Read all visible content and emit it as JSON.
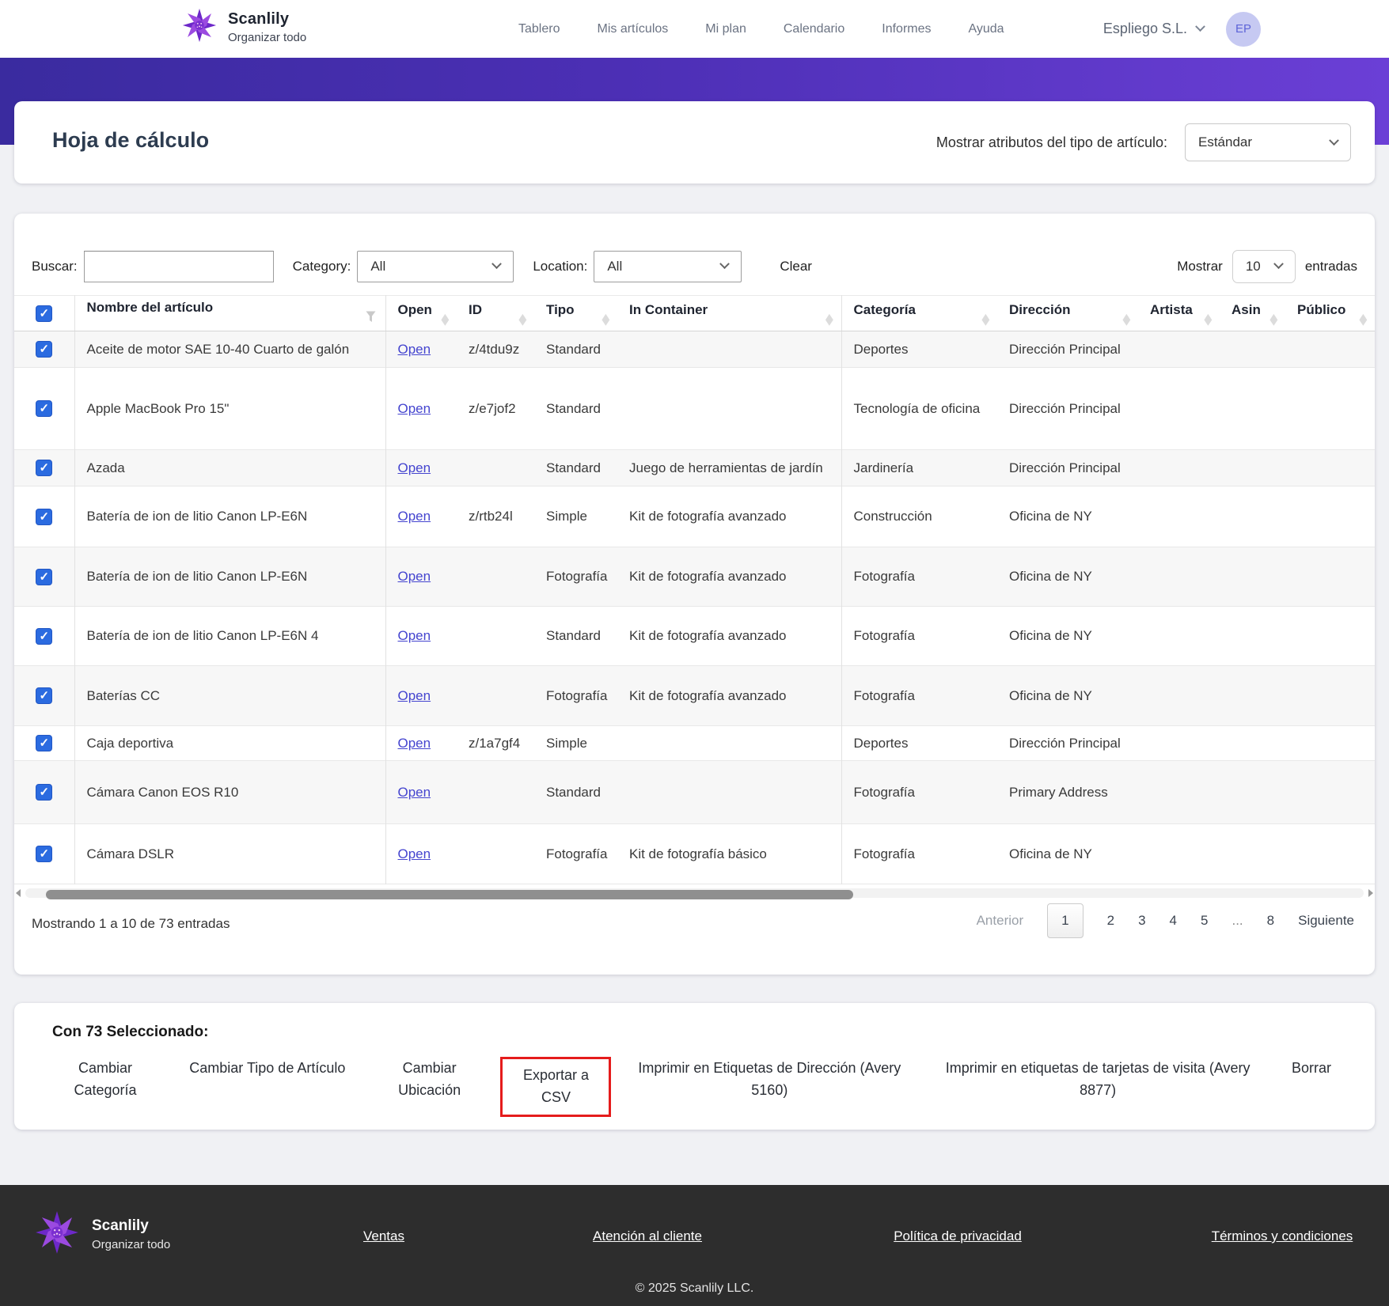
{
  "header": {
    "brand": {
      "name": "Scanlily",
      "tagline": "Organizar todo"
    },
    "nav": [
      {
        "key": "tablero",
        "label": "Tablero"
      },
      {
        "key": "mis-articulos",
        "label": "Mis artículos"
      },
      {
        "key": "mi-plan",
        "label": "Mi plan"
      },
      {
        "key": "calendario",
        "label": "Calendario"
      },
      {
        "key": "informes",
        "label": "Informes"
      },
      {
        "key": "ayuda",
        "label": "Ayuda"
      }
    ],
    "account": {
      "company": "Espliego S.L.",
      "avatar_initials": "EP"
    }
  },
  "page": {
    "title": "Hoja de cálculo",
    "attributes_label": "Mostrar atributos del tipo de artículo:",
    "attributes_value": "Estándar"
  },
  "filters": {
    "search_label": "Buscar:",
    "search_value": "",
    "category_label": "Category:",
    "category_value": "All",
    "location_label": "Location:",
    "location_value": "All",
    "clear_label": "Clear",
    "show_label": "Mostrar",
    "page_size": "10",
    "entries_label": "entradas"
  },
  "table": {
    "columns": [
      "Nombre del artículo",
      "Open",
      "ID",
      "Tipo",
      "In Container",
      "Categoría",
      "Dirección",
      "Artista",
      "Asin",
      "Público"
    ],
    "open_label": "Open",
    "rows": [
      {
        "name": "Aceite de motor SAE 10-40 Cuarto de galón",
        "id": "z/4tdu9z",
        "tipo": "Standard",
        "container": "",
        "categoria": "Deportes",
        "direccion": "Dirección Principal",
        "artista": "",
        "asin": "",
        "publico": ""
      },
      {
        "name": "Apple MacBook Pro 15\"",
        "id": "z/e7jof2",
        "tipo": "Standard",
        "container": "",
        "categoria": "Tecnología de oficina",
        "direccion": "Dirección Principal",
        "artista": "",
        "asin": "",
        "publico": ""
      },
      {
        "name": "Azada",
        "id": "",
        "tipo": "Standard",
        "container": "Juego de herramientas de jardín",
        "categoria": "Jardinería",
        "direccion": "Dirección Principal",
        "artista": "",
        "asin": "",
        "publico": ""
      },
      {
        "name": "Batería de ion de litio Canon LP-E6N",
        "id": "z/rtb24l",
        "tipo": "Simple",
        "container": "Kit de fotografía avanzado",
        "categoria": "Construcción",
        "direccion": "Oficina de NY",
        "artista": "",
        "asin": "",
        "publico": ""
      },
      {
        "name": "Batería de ion de litio Canon LP-E6N",
        "id": "",
        "tipo": "Fotografía",
        "container": "Kit de fotografía avanzado",
        "categoria": "Fotografía",
        "direccion": "Oficina de NY",
        "artista": "",
        "asin": "",
        "publico": ""
      },
      {
        "name": "Batería de ion de litio Canon LP-E6N 4",
        "id": "",
        "tipo": "Standard",
        "container": "Kit de fotografía avanzado",
        "categoria": "Fotografía",
        "direccion": "Oficina de NY",
        "artista": "",
        "asin": "",
        "publico": ""
      },
      {
        "name": "Baterías CC",
        "id": "",
        "tipo": "Fotografía",
        "container": "Kit de fotografía avanzado",
        "categoria": "Fotografía",
        "direccion": "Oficina de NY",
        "artista": "",
        "asin": "",
        "publico": ""
      },
      {
        "name": "Caja deportiva",
        "id": "z/1a7gf4",
        "tipo": "Simple",
        "container": "",
        "categoria": "Deportes",
        "direccion": "Dirección Principal",
        "artista": "",
        "asin": "",
        "publico": ""
      },
      {
        "name": "Cámara Canon EOS R10",
        "id": "",
        "tipo": "Standard",
        "container": "",
        "categoria": "Fotografía",
        "direccion": "Primary Address",
        "artista": "",
        "asin": "",
        "publico": ""
      },
      {
        "name": "Cámara DSLR",
        "id": "",
        "tipo": "Fotografía",
        "container": "Kit de fotografía básico",
        "categoria": "Fotografía",
        "direccion": "Oficina de NY",
        "artista": "",
        "asin": "",
        "publico": ""
      }
    ]
  },
  "pagination": {
    "summary": "Mostrando 1 a 10 de 73 entradas",
    "prev_label": "Anterior",
    "pages": [
      "1",
      "2",
      "3",
      "4",
      "5",
      "...",
      "8"
    ],
    "current_page": "1",
    "next_label": "Siguiente"
  },
  "bulk": {
    "title": "Con 73 Seleccionado:",
    "actions": [
      {
        "key": "cambiar-categoria",
        "label": "Cambiar Categoría",
        "highlight": false
      },
      {
        "key": "cambiar-tipo-de-articulo",
        "label": "Cambiar Tipo de Artículo",
        "highlight": false
      },
      {
        "key": "cambiar-ubicacion",
        "label": "Cambiar Ubicación",
        "highlight": false
      },
      {
        "key": "exportar-a-csv",
        "label": "Exportar a CSV",
        "highlight": true
      },
      {
        "key": "imprimir-etiquetas-direccion",
        "label": "Imprimir en Etiquetas de Dirección (Avery 5160)",
        "highlight": false
      },
      {
        "key": "imprimir-tarjetas-visita",
        "label": "Imprimir en etiquetas de tarjetas de visita (Avery 8877)",
        "highlight": false
      },
      {
        "key": "borrar",
        "label": "Borrar",
        "highlight": false
      }
    ]
  },
  "footer": {
    "brand": {
      "name": "Scanlily",
      "tagline": "Organizar todo"
    },
    "links": [
      {
        "key": "ventas",
        "label": "Ventas"
      },
      {
        "key": "atencion-al-cliente",
        "label": "Atención al cliente"
      },
      {
        "key": "politica-de-privacidad",
        "label": "Política de privacidad"
      },
      {
        "key": "terminos-y-condiciones",
        "label": "Términos y condiciones"
      }
    ],
    "copyright": "© 2025 Scanlily LLC."
  },
  "icons": {
    "sort_indicator": "◆",
    "chevron_down": "chevron-down",
    "name_filter": "funnel",
    "logo": "purple-lily-flower"
  },
  "colors": {
    "banner_gradient_left": "#3a2b9f",
    "banner_gradient_right": "#6b3fd6",
    "checkbox_blue": "#2b6be0",
    "open_link": "#4444cf",
    "highlight_red": "#e51c1c",
    "footer_bg": "#2d2d2d",
    "avatar_bg": "#c6c9f2",
    "avatar_text": "#5d64d8"
  }
}
